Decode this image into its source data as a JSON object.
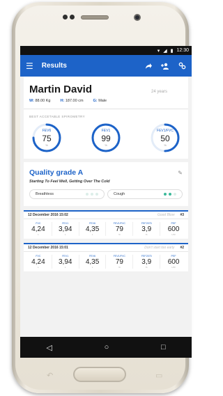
{
  "status": {
    "time": "12:30"
  },
  "appbar": {
    "title": "Results"
  },
  "patient": {
    "name": "Martin David",
    "age": "24 years",
    "weight_key": "W:",
    "weight": "88.00 Kg",
    "height_key": "H:",
    "height": "187.00 cm",
    "gender_key": "G:",
    "gender": "Male"
  },
  "spirometry": {
    "label": "BEST ACCETABLE SPIROMETRY",
    "gauges": [
      {
        "name": "FEV6",
        "value": "75",
        "unit": "%",
        "fraction": 0.75
      },
      {
        "name": "FEV1",
        "value": "99",
        "unit": "%",
        "fraction": 0.99
      },
      {
        "name": "FEV1/FVC",
        "value": "50",
        "unit": "%",
        "fraction": 0.5
      }
    ]
  },
  "quality": {
    "grade": "Quality grade A",
    "note": "Starting To Feel Well, Getting Over The Cold",
    "chips": [
      {
        "label": "Breathless",
        "level": 0
      },
      {
        "label": "Cough",
        "level": 2
      }
    ]
  },
  "tests": [
    {
      "date": "12 December 2016 15:02",
      "comment": "Good Blow",
      "number": "#3",
      "metrics": [
        {
          "name": "FVC",
          "value": "4,24",
          "unit": "L"
        },
        {
          "name": "FEV1",
          "value": "3,94",
          "unit": "L"
        },
        {
          "name": "FEV6",
          "value": "4,35",
          "unit": "L"
        },
        {
          "name": "FEV1/FVC",
          "value": "79",
          "unit": "%"
        },
        {
          "name": "FEF2575",
          "value": "3,9",
          "unit": "%"
        },
        {
          "name": "PEF",
          "value": "600",
          "unit": "L/M"
        }
      ]
    },
    {
      "date": "12 December 2016 15:01",
      "comment": "Don't start too early",
      "number": "#2",
      "metrics": [
        {
          "name": "FVC",
          "value": "4,24",
          "unit": "L"
        },
        {
          "name": "FEV1",
          "value": "3,94",
          "unit": "L"
        },
        {
          "name": "FEV6",
          "value": "4,35",
          "unit": "L"
        },
        {
          "name": "FEV1/FVC",
          "value": "79",
          "unit": "%"
        },
        {
          "name": "FEF2575",
          "value": "3,9",
          "unit": "%"
        },
        {
          "name": "PEF",
          "value": "600",
          "unit": "L/M"
        }
      ]
    }
  ],
  "colors": {
    "accent": "#1d63c8",
    "gauge_track": "#e3ecf8",
    "teal": "#3cb99a"
  },
  "icons": [
    "menu-icon",
    "share-icon",
    "add-person-icon",
    "settings-icon",
    "back-icon",
    "home-icon",
    "recents-icon",
    "edit-icon"
  ]
}
